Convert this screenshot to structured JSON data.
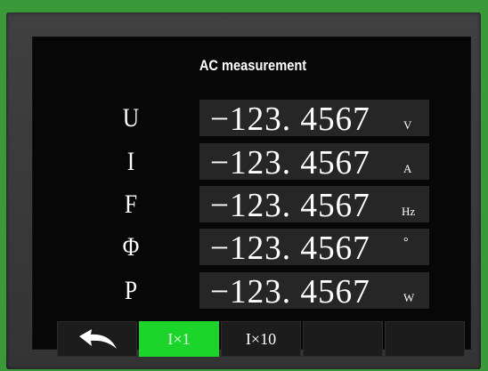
{
  "screen": {
    "title": "AC measurement"
  },
  "readings": [
    {
      "symbol": "U",
      "value": "−123. 4567",
      "unit": "V"
    },
    {
      "symbol": "I",
      "value": "−123. 4567",
      "unit": "A"
    },
    {
      "symbol": "F",
      "value": "−123. 4567",
      "unit": "Hz"
    },
    {
      "symbol": "Φ",
      "value": "−123. 4567",
      "unit": "°"
    },
    {
      "symbol": "P",
      "value": "−123. 4567",
      "unit": "W"
    }
  ],
  "buttons": {
    "back_icon": "back-arrow-icon",
    "x1_label": "I×1",
    "x10_label": "I×10",
    "active": "x1",
    "active_color": "#1cd52a"
  },
  "colors": {
    "outer_background": "#3a9a3a",
    "screen_background": "#070707",
    "value_box": "#262626"
  }
}
